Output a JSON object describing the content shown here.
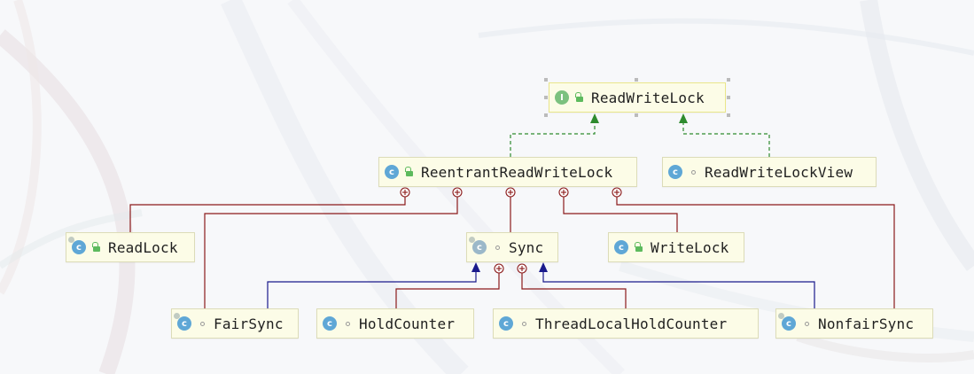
{
  "diagram": {
    "nodes": [
      {
        "id": "ReadWriteLock",
        "label": "ReadWriteLock",
        "kind": "interface",
        "visibility": "public"
      },
      {
        "id": "ReentrantReadWriteLock",
        "label": "ReentrantReadWriteLock",
        "kind": "class",
        "visibility": "public"
      },
      {
        "id": "ReadWriteLockView",
        "label": "ReadWriteLockView",
        "kind": "class",
        "visibility": "package"
      },
      {
        "id": "ReadLock",
        "label": "ReadLock",
        "kind": "static-class",
        "visibility": "public"
      },
      {
        "id": "Sync",
        "label": "Sync",
        "kind": "abstract-class",
        "visibility": "package"
      },
      {
        "id": "WriteLock",
        "label": "WriteLock",
        "kind": "class",
        "visibility": "public"
      },
      {
        "id": "FairSync",
        "label": "FairSync",
        "kind": "static-class",
        "visibility": "package"
      },
      {
        "id": "HoldCounter",
        "label": "HoldCounter",
        "kind": "class",
        "visibility": "package"
      },
      {
        "id": "ThreadLocalHoldCounter",
        "label": "ThreadLocalHoldCounter",
        "kind": "class",
        "visibility": "package"
      },
      {
        "id": "NonfairSync",
        "label": "NonfairSync",
        "kind": "static-class",
        "visibility": "package"
      }
    ],
    "relations": [
      {
        "from": "ReentrantReadWriteLock",
        "to": "ReadWriteLock",
        "type": "implements"
      },
      {
        "from": "ReadWriteLockView",
        "to": "ReadWriteLock",
        "type": "implements"
      },
      {
        "from": "ReadLock",
        "to": "ReentrantReadWriteLock",
        "type": "inner"
      },
      {
        "from": "FairSync",
        "to": "ReentrantReadWriteLock",
        "type": "inner"
      },
      {
        "from": "Sync",
        "to": "ReentrantReadWriteLock",
        "type": "inner"
      },
      {
        "from": "WriteLock",
        "to": "ReentrantReadWriteLock",
        "type": "inner"
      },
      {
        "from": "NonfairSync",
        "to": "ReentrantReadWriteLock",
        "type": "inner"
      },
      {
        "from": "FairSync",
        "to": "Sync",
        "type": "extends"
      },
      {
        "from": "NonfairSync",
        "to": "Sync",
        "type": "extends"
      },
      {
        "from": "HoldCounter",
        "to": "Sync",
        "type": "inner"
      },
      {
        "from": "ThreadLocalHoldCounter",
        "to": "Sync",
        "type": "inner"
      }
    ],
    "selected_node": "ReadWriteLock",
    "colors": {
      "implements": "#2e8b2e",
      "extends": "#1a1a8c",
      "inner": "#8b1a1a",
      "node_fill": "#fcfce6",
      "class_icon": "#5fa7d6",
      "interface_icon": "#7bc17f",
      "lock_icon": "#5dba5d"
    }
  }
}
